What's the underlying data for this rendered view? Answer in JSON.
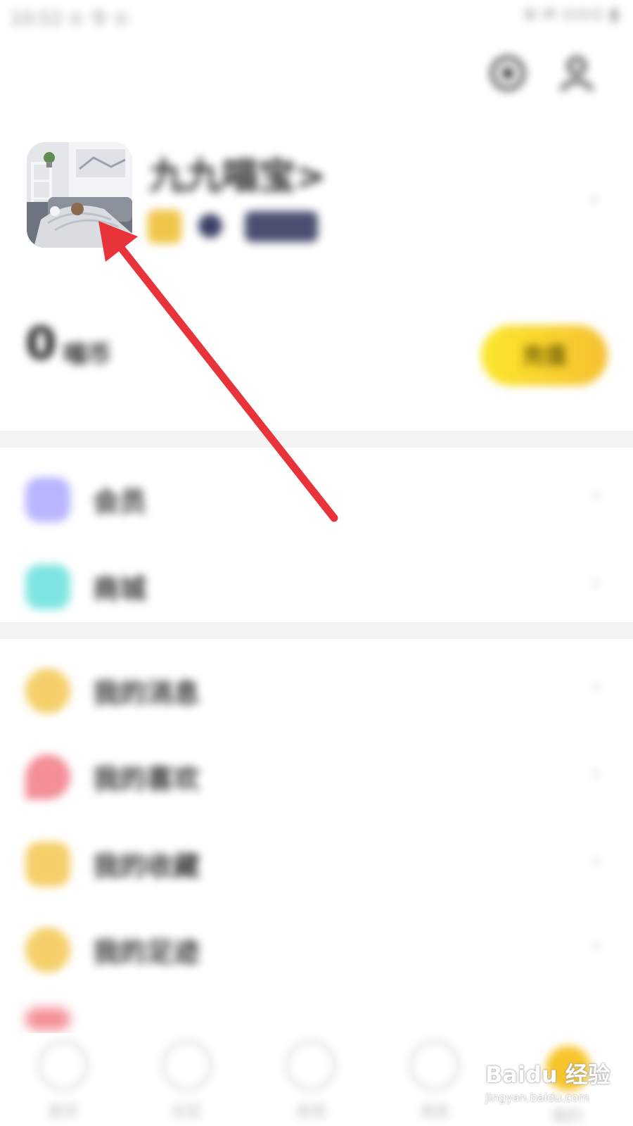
{
  "status_bar": {
    "left_text": "10:52 ⊙ 令 ⊙",
    "right_text": "⊕ ✉ ⊙⊙⊙ ▮"
  },
  "header": {
    "settings_icon": "settings-icon",
    "profile_icon": "person-icon"
  },
  "profile": {
    "username": "九九喵宝>",
    "tag_label": "",
    "subtitle": ""
  },
  "balance": {
    "value": "0",
    "unit": "喵币",
    "description": "",
    "recharge_label": "充值"
  },
  "section1": [
    {
      "label": "会员",
      "value": "",
      "icon_color": "#b9b6ff"
    },
    {
      "label": "商城",
      "value": "",
      "icon_color": "#7fe5e2"
    }
  ],
  "section2": [
    {
      "label": "我的消息",
      "value": "",
      "icon_color": "#f5cf6a"
    },
    {
      "label": "我的喜欢",
      "value": "",
      "icon_color": "#f48f98"
    },
    {
      "label": "我的收藏",
      "value": "",
      "icon_color": "#f5cf6a"
    },
    {
      "label": "我的足迹",
      "value": "",
      "icon_color": "#f5cf6a"
    }
  ],
  "bottom_nav": [
    {
      "label": "首页"
    },
    {
      "label": "社区"
    },
    {
      "label": "发现"
    },
    {
      "label": "消息"
    },
    {
      "label": "我的"
    }
  ],
  "colors": {
    "accent_yellow": "#f6c52b",
    "annotation_red": "#e8333a"
  },
  "watermark": {
    "logo": "Baidu 经验",
    "url": "jingyan.baidu.com"
  }
}
